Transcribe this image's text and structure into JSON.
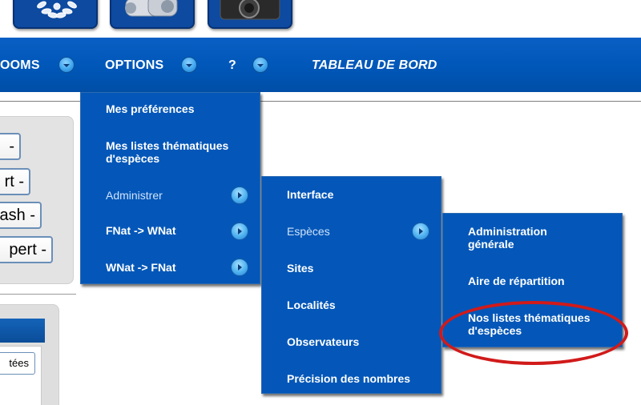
{
  "top_images": [
    {
      "name": "laurel-logo"
    },
    {
      "name": "binoculars"
    },
    {
      "name": "camera"
    }
  ],
  "nav": {
    "rooms": "OOMS",
    "options": "OPTIONS",
    "help": "?",
    "dashboard": "TABLEAU DE BORD"
  },
  "left_panel": {
    "buttons": [
      "-",
      "rt -",
      "ash -",
      "pert -"
    ],
    "tab_label": "tées"
  },
  "options_menu": {
    "items": [
      {
        "label": "Mes préférences"
      },
      {
        "label": "Mes listes thématiques d'espèces"
      },
      {
        "label": "Administrer",
        "submenu": true,
        "selected": true
      },
      {
        "label": "FNat -> WNat",
        "submenu": true
      },
      {
        "label": "WNat -> FNat",
        "submenu": true
      }
    ]
  },
  "administrer_menu": {
    "items": [
      {
        "label": "Interface"
      },
      {
        "label": "Espèces",
        "submenu": true,
        "selected": true
      },
      {
        "label": "Sites"
      },
      {
        "label": "Localités"
      },
      {
        "label": "Observateurs"
      },
      {
        "label": "Précision des nombres"
      }
    ]
  },
  "especes_menu": {
    "items": [
      {
        "label": "Administration générale"
      },
      {
        "label": "Aire de répartition"
      },
      {
        "label": "Nos listes thématiques d'espèces",
        "highlighted": true
      }
    ]
  },
  "colors": {
    "nav_blue": "#0057b8",
    "menu_blue": "#0457b8",
    "highlight_red": "#d11a1a"
  }
}
